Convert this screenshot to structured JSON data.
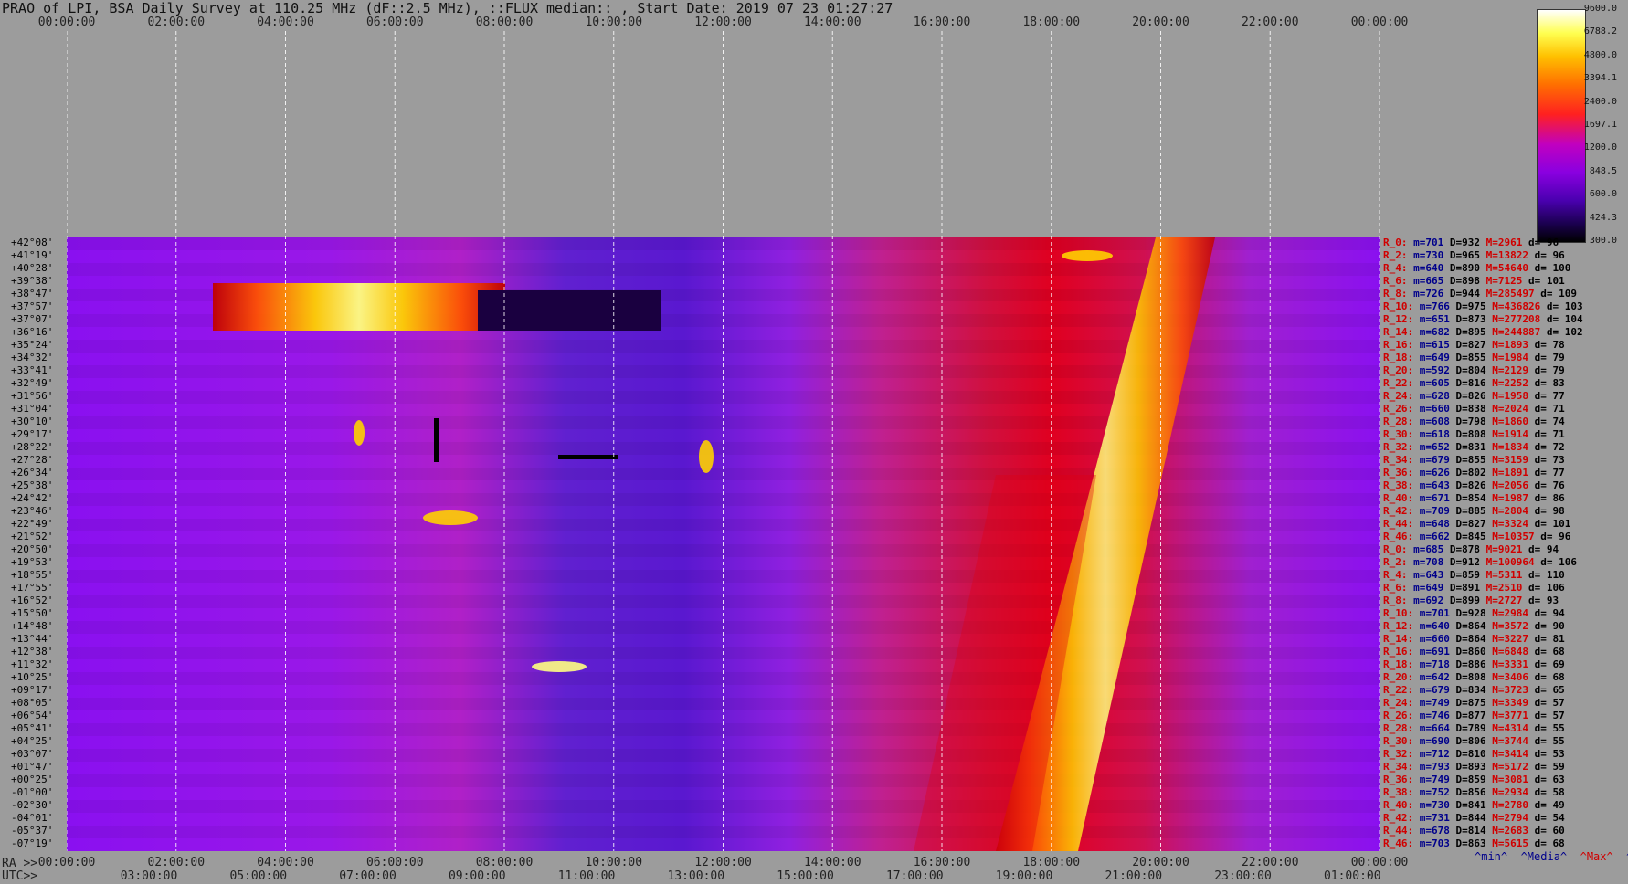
{
  "title": "PRAO of LPI, BSA Daily Survey at 110.25 MHz (dF::2.5 MHz), ::FLUX_median:: , Start Date: 2019 07 23 01:27:27",
  "chart_data": {
    "type": "heatmap",
    "x_top_ticks": [
      "00:00:00",
      "02:00:00",
      "04:00:00",
      "06:00:00",
      "08:00:00",
      "10:00:00",
      "12:00:00",
      "14:00:00",
      "16:00:00",
      "18:00:00",
      "20:00:00",
      "22:00:00",
      "00:00:00"
    ],
    "x_ra_ticks": [
      "00:00:00",
      "02:00:00",
      "04:00:00",
      "06:00:00",
      "08:00:00",
      "10:00:00",
      "12:00:00",
      "14:00:00",
      "16:00:00",
      "18:00:00",
      "20:00:00",
      "22:00:00",
      "00:00:00"
    ],
    "x_utc_ticks": [
      "03:00:00",
      "05:00:00",
      "07:00:00",
      "09:00:00",
      "11:00:00",
      "13:00:00",
      "15:00:00",
      "17:00:00",
      "19:00:00",
      "21:00:00",
      "23:00:00",
      "01:00:00"
    ],
    "ra_label": "RA >>",
    "utc_label": "UTC>>",
    "declinations": [
      "+42°08'",
      "+41°19'",
      "+40°28'",
      "+39°38'",
      "+38°47'",
      "+37°57'",
      "+37°07'",
      "+36°16'",
      "+35°24'",
      "+34°32'",
      "+33°41'",
      "+32°49'",
      "+31°56'",
      "+31°04'",
      "+30°10'",
      "+29°17'",
      "+28°22'",
      "+27°28'",
      "+26°34'",
      "+25°38'",
      "+24°42'",
      "+23°46'",
      "+22°49'",
      "+21°52'",
      "+20°50'",
      "+19°53'",
      "+18°55'",
      "+17°55'",
      "+16°52'",
      "+15°50'",
      "+14°48'",
      "+13°44'",
      "+12°38'",
      "+11°32'",
      "+10°25'",
      "+09°17'",
      "+08°05'",
      "+06°54'",
      "+05°41'",
      "+04°25'",
      "+03°07'",
      "+01°47'",
      "+00°25'",
      "-01°00'",
      "-02°30'",
      "-04°01'",
      "-05°37'",
      "-07°19'"
    ],
    "colorbar": {
      "labels": [
        "9600.0",
        "6788.2",
        "4800.0",
        "3394.1",
        "2400.0",
        "1697.1",
        "1200.0",
        "848.5",
        "600.0",
        "424.3",
        "300.0"
      ],
      "min": 300.0,
      "max": 9600.0,
      "scale": "log"
    },
    "row_stats": [
      [
        "R_0:",
        "m=701",
        "D=932",
        "M=2961",
        "d= 96"
      ],
      [
        "R_2:",
        "m=730",
        "D=965",
        "M=13822",
        "d= 96"
      ],
      [
        "R_4:",
        "m=640",
        "D=890",
        "M=54640",
        "d= 100"
      ],
      [
        "R_6:",
        "m=665",
        "D=898",
        "M=7125",
        "d= 101"
      ],
      [
        "R_8:",
        "m=726",
        "D=944",
        "M=285497",
        "d= 109"
      ],
      [
        "R_10:",
        "m=766",
        "D=975",
        "M=436826",
        "d= 103"
      ],
      [
        "R_12:",
        "m=651",
        "D=873",
        "M=277208",
        "d= 104"
      ],
      [
        "R_14:",
        "m=682",
        "D=895",
        "M=244887",
        "d= 102"
      ],
      [
        "R_16:",
        "m=615",
        "D=827",
        "M=1893",
        "d= 78"
      ],
      [
        "R_18:",
        "m=649",
        "D=855",
        "M=1984",
        "d= 79"
      ],
      [
        "R_20:",
        "m=592",
        "D=804",
        "M=2129",
        "d= 79"
      ],
      [
        "R_22:",
        "m=605",
        "D=816",
        "M=2252",
        "d= 83"
      ],
      [
        "R_24:",
        "m=628",
        "D=826",
        "M=1958",
        "d= 77"
      ],
      [
        "R_26:",
        "m=660",
        "D=838",
        "M=2024",
        "d= 71"
      ],
      [
        "R_28:",
        "m=608",
        "D=798",
        "M=1860",
        "d= 74"
      ],
      [
        "R_30:",
        "m=618",
        "D=808",
        "M=1914",
        "d= 71"
      ],
      [
        "R_32:",
        "m=652",
        "D=831",
        "M=1834",
        "d= 72"
      ],
      [
        "R_34:",
        "m=679",
        "D=855",
        "M=3159",
        "d= 73"
      ],
      [
        "R_36:",
        "m=626",
        "D=802",
        "M=1891",
        "d= 77"
      ],
      [
        "R_38:",
        "m=643",
        "D=826",
        "M=2056",
        "d= 76"
      ],
      [
        "R_40:",
        "m=671",
        "D=854",
        "M=1987",
        "d= 86"
      ],
      [
        "R_42:",
        "m=709",
        "D=885",
        "M=2804",
        "d= 98"
      ],
      [
        "R_44:",
        "m=648",
        "D=827",
        "M=3324",
        "d= 101"
      ],
      [
        "R_46:",
        "m=662",
        "D=845",
        "M=10357",
        "d= 96"
      ],
      [
        "R_0:",
        "m=685",
        "D=878",
        "M=9021",
        "d= 94"
      ],
      [
        "R_2:",
        "m=708",
        "D=912",
        "M=100964",
        "d= 106"
      ],
      [
        "R_4:",
        "m=643",
        "D=859",
        "M=5311",
        "d= 110"
      ],
      [
        "R_6:",
        "m=649",
        "D=891",
        "M=2510",
        "d= 106"
      ],
      [
        "R_8:",
        "m=692",
        "D=899",
        "M=2727",
        "d= 93"
      ],
      [
        "R_10:",
        "m=701",
        "D=928",
        "M=2984",
        "d= 94"
      ],
      [
        "R_12:",
        "m=640",
        "D=864",
        "M=3572",
        "d= 90"
      ],
      [
        "R_14:",
        "m=660",
        "D=864",
        "M=3227",
        "d= 81"
      ],
      [
        "R_16:",
        "m=691",
        "D=860",
        "M=6848",
        "d= 68"
      ],
      [
        "R_18:",
        "m=718",
        "D=886",
        "M=3331",
        "d= 69"
      ],
      [
        "R_20:",
        "m=642",
        "D=808",
        "M=3406",
        "d= 68"
      ],
      [
        "R_22:",
        "m=679",
        "D=834",
        "M=3723",
        "d= 65"
      ],
      [
        "R_24:",
        "m=749",
        "D=875",
        "M=3349",
        "d= 57"
      ],
      [
        "R_26:",
        "m=746",
        "D=877",
        "M=3771",
        "d= 57"
      ],
      [
        "R_28:",
        "m=664",
        "D=789",
        "M=4314",
        "d= 55"
      ],
      [
        "R_30:",
        "m=690",
        "D=806",
        "M=3744",
        "d= 55"
      ],
      [
        "R_32:",
        "m=712",
        "D=810",
        "M=3414",
        "d= 53"
      ],
      [
        "R_34:",
        "m=793",
        "D=893",
        "M=5172",
        "d= 59"
      ],
      [
        "R_36:",
        "m=749",
        "D=859",
        "M=3081",
        "d= 63"
      ],
      [
        "R_38:",
        "m=752",
        "D=856",
        "M=2934",
        "d= 58"
      ],
      [
        "R_40:",
        "m=730",
        "D=841",
        "M=2780",
        "d= 49"
      ],
      [
        "R_42:",
        "m=731",
        "D=844",
        "M=2794",
        "d= 54"
      ],
      [
        "R_44:",
        "m=678",
        "D=814",
        "M=2683",
        "d= 60"
      ],
      [
        "R_46:",
        "m=703",
        "D=863",
        "M=5615",
        "d= 68"
      ]
    ],
    "legend": [
      "^min^",
      "^Media^",
      "^Max^",
      "^devia^"
    ],
    "grid": true
  },
  "colors": {
    "background": "#9c9c9c",
    "min": "#00008b",
    "max": "#d00000",
    "text": "#111111"
  }
}
